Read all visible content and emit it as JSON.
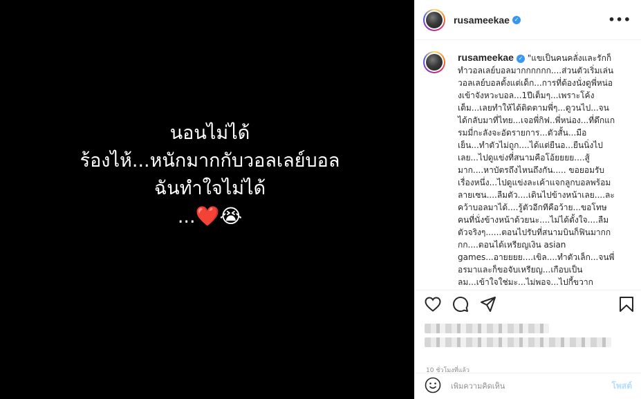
{
  "image": {
    "lines": [
      "นอนไม่ได้",
      "ร้องไห้...หนักมากกับวอลเลย์บอล",
      "ฉันทำใจไม่ได้",
      "..."
    ],
    "emojis": [
      "❤️",
      "😭"
    ]
  },
  "header": {
    "username": "rusameekae",
    "verified_glyph": "✓",
    "more_glyph": "•••"
  },
  "caption": {
    "username": "rusameekae",
    "text": "\"แขเป็นคนคลั่งและรักก็ทำวอลเลย์บอลมากกกกกก....ส่วนตัวเริ่มเล่นวอลเลย์บอลตั้งแต่เด็ก...การที่ต้องนั่งดูพี่หน่องเข้าจังหวะบอล...1ปีเต็มๆ...เพราะโค้งเต็ม...เลยทำให้ได้ติดตามพี่ๆ...ดูวนไป...จนได้กลับมาที่ไทย...เจอพี่กิฟ..พี่หน่อง...ที่ดึกแกรมมี่กะลังจะอัดรายการ...ตัวสั้น...มือเย็น...ทำตัวไม่ถูก....ได้แต่ยืนอ...ยืนนิ่งไปเลย...ไปดูแข่งที่สนามคือโอ้ยยยย....สู้มาก....หาบัตรถึงไหนถึงกัน..... ขอยอมรับเรื่องหนึ่ง...ไปดูแข่งละเค้าแจกลูกบอลพร้อมลายเซน....ลืมตัว....เดินไปข้างหน้าเลย....ละคว้าบอลมาได้....รู้ตัวอีกทีคือว้าย...ขอโทษคนที่นั่งข้างหน้าด้วยนะ....ไม่ได้ตั้งใจ....ลืมตัวจริงๆ......ตอนไปรับที่สนามบินก็ฟินมากกกก....ตอนได้เหรียญเงิน asian games...อายยยย....เขิล....ทำตัวเล็ก...จนพี่อรมาและก็ขอจับเหรียญ...เกือบเป็นลม...เข้าใจใช่มะ...ไม่พอจ...ไปกี้ขวาก"
  },
  "timestamp": "10 ชั่วโมงที่แล้ว",
  "comment": {
    "placeholder": "เพิ่มความคิดเห็น",
    "post_label": "โพสต์"
  },
  "colors": {
    "verified": "#3897f0",
    "post_button_disabled": "#b2dffc",
    "image_bg": "#000000"
  }
}
